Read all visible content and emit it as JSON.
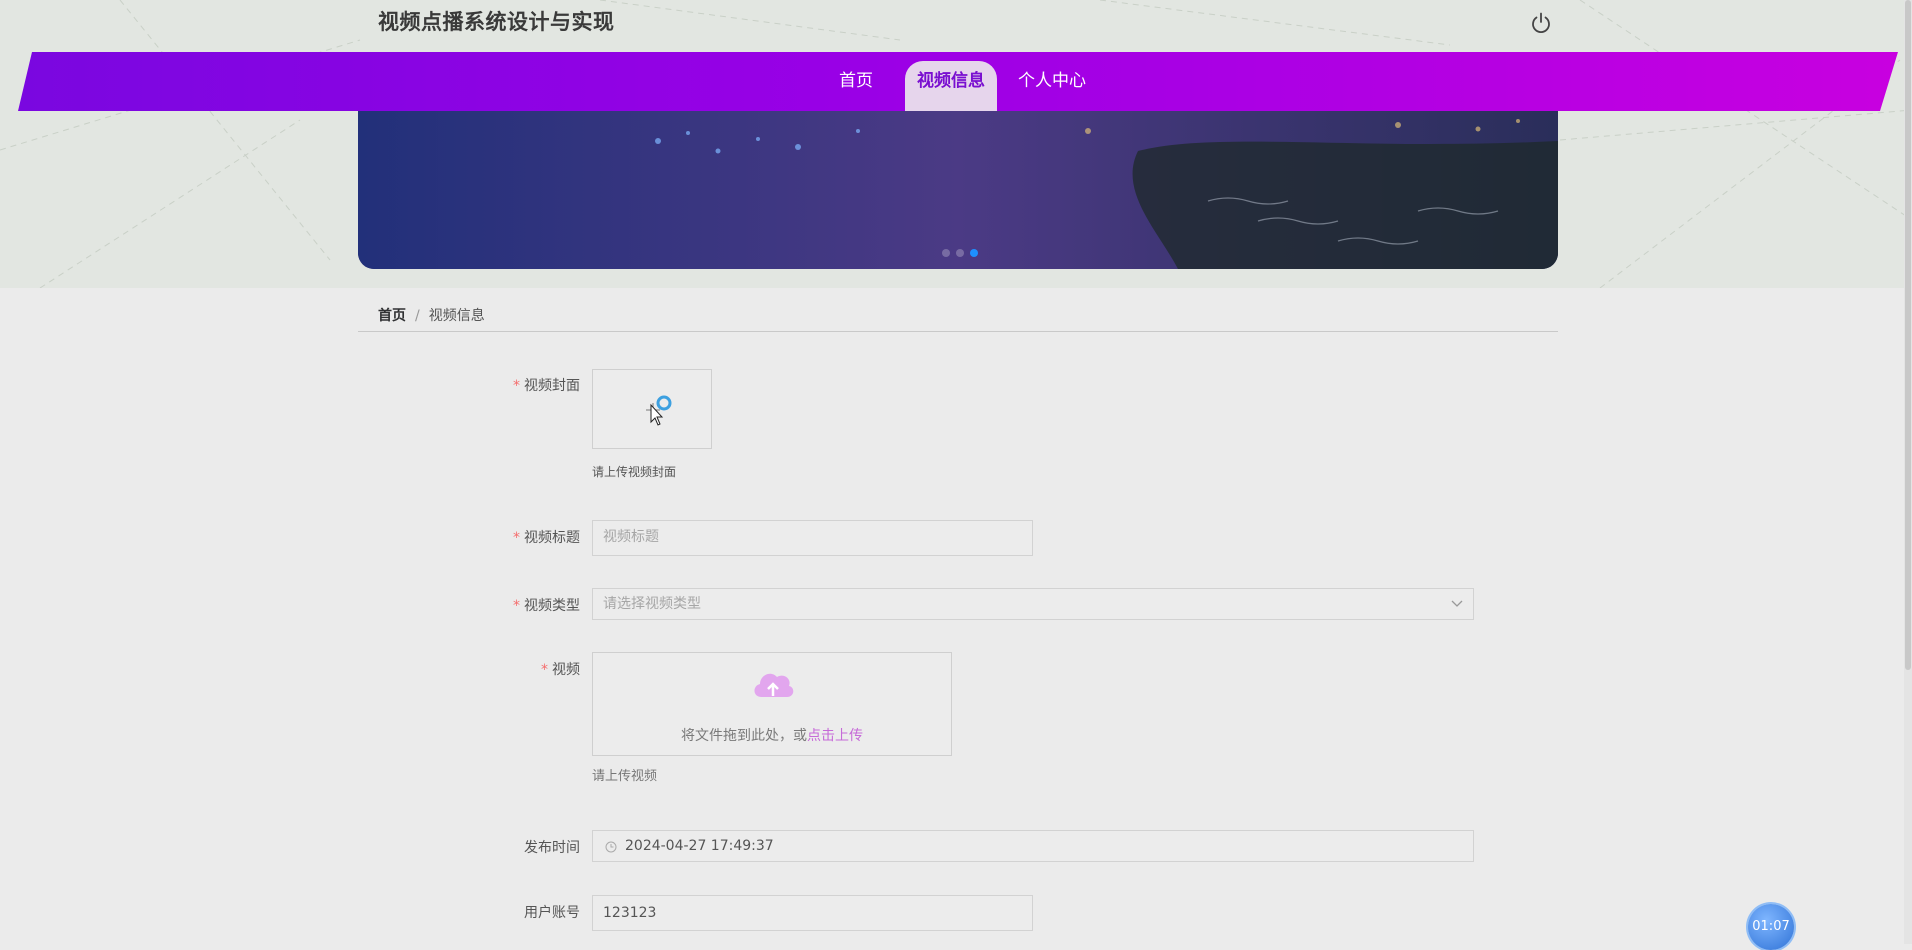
{
  "header": {
    "title": "视频点播系统设计与实现",
    "nav": [
      {
        "label": "首页"
      },
      {
        "label": "视频信息"
      },
      {
        "label": "个人中心"
      }
    ]
  },
  "breadcrumb": {
    "home": "首页",
    "separator": "/",
    "current": "视频信息"
  },
  "form": {
    "cover": {
      "label": "视频封面",
      "hint": "请上传视频封面"
    },
    "title": {
      "label": "视频标题",
      "placeholder": "视频标题"
    },
    "type": {
      "label": "视频类型",
      "placeholder": "请选择视频类型"
    },
    "video": {
      "label": "视频",
      "drop_text": "将文件拖到此处，或",
      "drop_link": "点击上传",
      "hint": "请上传视频"
    },
    "publish_time": {
      "label": "发布时间",
      "value": "2024-04-27 17:49:37"
    },
    "account": {
      "label": "用户账号",
      "value": "123123"
    }
  },
  "timer": {
    "value": "01:07"
  },
  "colors": {
    "nav_start": "#7a07e0",
    "nav_end": "#c800e0",
    "active_tab_text": "#7a0fd0",
    "required_star": "#f56c6c",
    "upload_link": "#c66ad8"
  }
}
